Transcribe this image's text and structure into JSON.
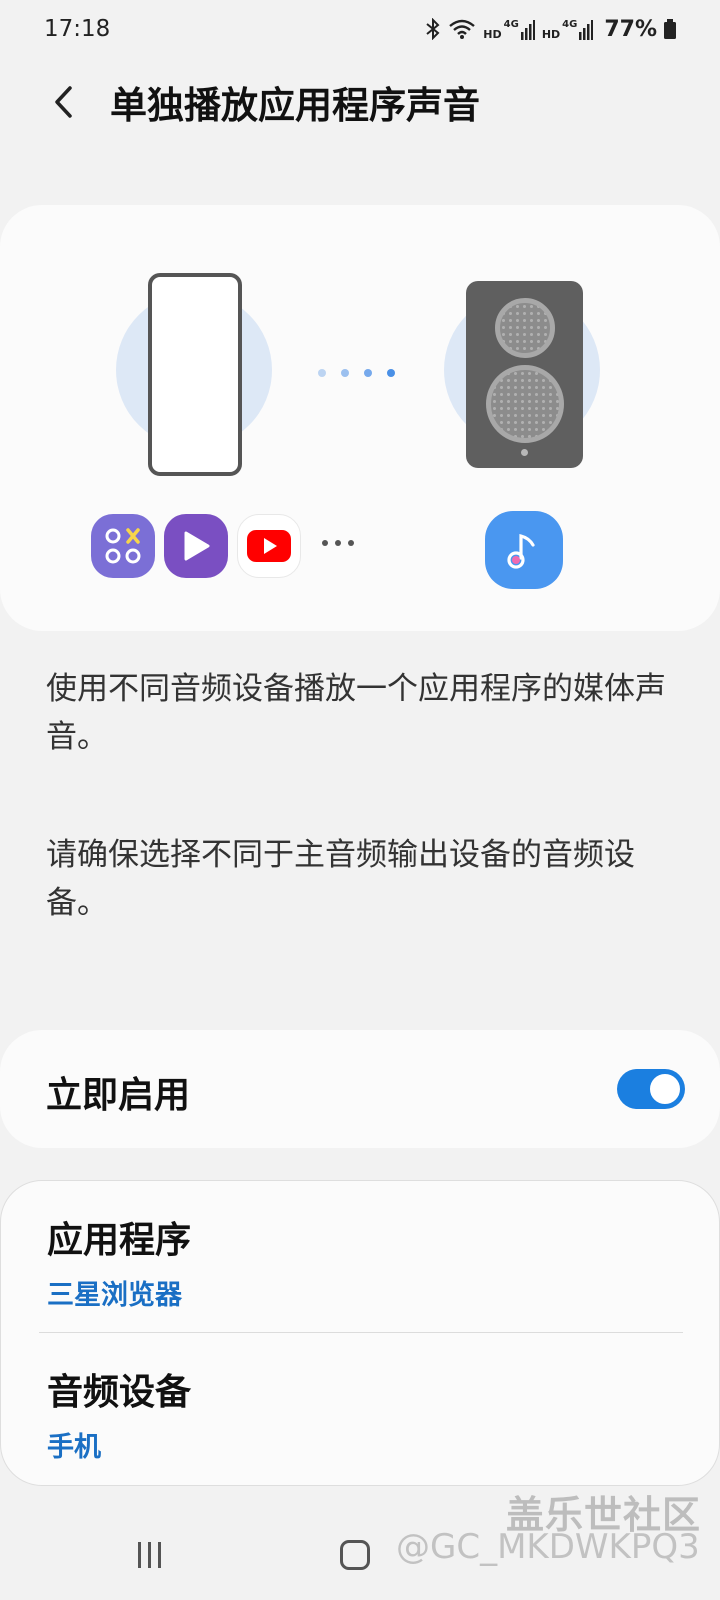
{
  "status_bar": {
    "time": "17:18",
    "network1_hd": "HD",
    "network1_type": "4G",
    "network2_hd": "HD",
    "network2_type": "4G",
    "battery": "77%",
    "icons": [
      "bluetooth-icon",
      "wifi-icon",
      "signal-icon",
      "battery-icon"
    ]
  },
  "header": {
    "title": "单独播放应用程序声音",
    "back_icon": "chevron-left-icon"
  },
  "illustration": {
    "source_apps": [
      "game-launcher-icon",
      "video-player-icon",
      "youtube-icon"
    ],
    "target_app": "music-icon",
    "colors": {
      "circle": "#dde8f6",
      "speaker": "#5f5f5f",
      "accent": "#4a97f0",
      "game_launcher": "#7b6fd6",
      "video_player": "#7a4fc2",
      "youtube": "#ff0000"
    }
  },
  "description": {
    "paragraph1": "使用不同音频设备播放一个应用程序的媒体声音。",
    "paragraph2": "请确保选择不同于主音频输出设备的音频设备。"
  },
  "toggle": {
    "label": "立即启用",
    "enabled": true,
    "color": "#1b7fe0"
  },
  "settings": {
    "app": {
      "title": "应用程序",
      "value": "三星浏览器"
    },
    "audio_device": {
      "title": "音频设备",
      "value": "手机"
    },
    "value_color": "#1a6fc4"
  },
  "watermark": {
    "line1": "盖乐世社区",
    "line2": "@GC_MKDWKPQ3"
  }
}
